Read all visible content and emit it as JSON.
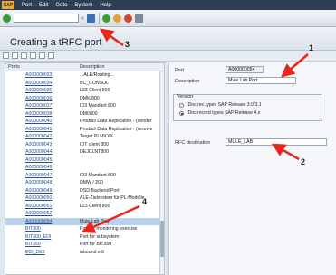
{
  "menubar": {
    "logo": "SAP",
    "items": [
      "Port",
      "Edit",
      "Goto",
      "System",
      "Help"
    ]
  },
  "toolbar": {
    "command_field_placeholder": "",
    "icons": [
      "check-icon",
      "save-icon",
      "back-icon",
      "exit-icon",
      "cancel-icon",
      "print-icon"
    ]
  },
  "title": "Creating a tRFC port",
  "list": {
    "headers": [
      "Ports",
      "Description"
    ],
    "rows": [
      {
        "port": "A000000033",
        "desc": "...ALE/Routing...",
        "selected": false
      },
      {
        "port": "A000000034",
        "desc": "BC_CONSOL",
        "selected": false
      },
      {
        "port": "A000000035",
        "desc": "L23 Client 800",
        "selected": false
      },
      {
        "port": "A000000036",
        "desc": "DMK/800",
        "selected": false
      },
      {
        "port": "A000000037",
        "desc": "ID3 Mandant 800",
        "selected": false
      },
      {
        "port": "A000000038",
        "desc": "DMI/800",
        "selected": false
      },
      {
        "port": "A000000040",
        "desc": "Product Data Replication - (sender",
        "selected": false
      },
      {
        "port": "A000000041",
        "desc": "Product Data Replication - (receive",
        "selected": false
      },
      {
        "port": "A000000042",
        "desc": "Target PLMXXX",
        "selected": false
      },
      {
        "port": "A000000043",
        "desc": "IDT client 800",
        "selected": false
      },
      {
        "port": "A000000044",
        "desc": "DEJCLNT800",
        "selected": false
      },
      {
        "port": "A000000045",
        "desc": "",
        "selected": false
      },
      {
        "port": "A000000046",
        "desc": "",
        "selected": false
      },
      {
        "port": "A000000047",
        "desc": "ID3 Mandant 800",
        "selected": false
      },
      {
        "port": "A000000048",
        "desc": "DMW / 200",
        "selected": false
      },
      {
        "port": "A000000049",
        "desc": "DSD Backend Port",
        "selected": false
      },
      {
        "port": "A000000050",
        "desc": "ALE-Zielsystem für PL-Modelle",
        "selected": false
      },
      {
        "port": "A000000051",
        "desc": "L23 Client 800",
        "selected": false
      },
      {
        "port": "A000000052",
        "desc": "",
        "selected": false
      },
      {
        "port": "A000000054",
        "desc": "Mule Lab Port",
        "selected": true
      },
      {
        "port": "BIT300",
        "desc": "Port for monitoring exercise",
        "selected": false
      },
      {
        "port": "BIT300_EDI",
        "desc": "Port for subsystem",
        "selected": false
      },
      {
        "port": "BIT350",
        "desc": "Port for BIT350",
        "selected": false
      },
      {
        "port": "EDI_DE3",
        "desc": "inbound edi",
        "selected": false
      }
    ]
  },
  "form": {
    "port_label": "Port",
    "port_value": "A000000054",
    "description_label": "Description",
    "description_value": "Mule Lab Port",
    "version_caption": "Version",
    "version_options": [
      {
        "label": "IDoc rec.types SAP Release 3.0/3.1",
        "checked": false
      },
      {
        "label": "IDoc record types SAP Release 4.x",
        "checked": true
      }
    ],
    "rfc_label": "RFC destination",
    "rfc_value": "MULE_LAB"
  },
  "callouts": [
    "1",
    "2",
    "3",
    "4"
  ]
}
